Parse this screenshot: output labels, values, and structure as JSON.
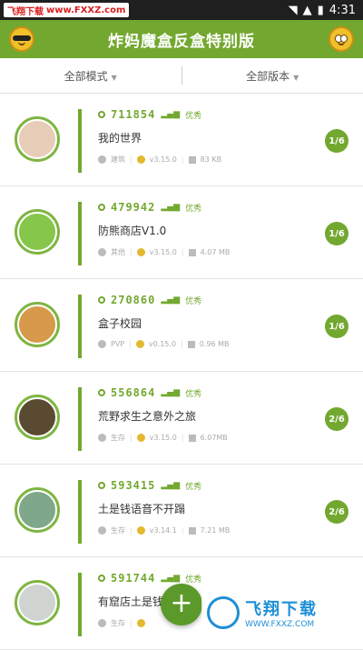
{
  "status_bar": {
    "watermark_site": "飞翔下载",
    "watermark_url": "www.FXXZ.com",
    "time": "4:31"
  },
  "header": {
    "title": "炸妈魔盒反盒特别版",
    "left_icon": "sunglasses-face-icon",
    "right_icon": "smile-face-icon"
  },
  "filters": {
    "mode": "全部模式",
    "version": "全部版本"
  },
  "items": [
    {
      "count": "711854",
      "quality": "优秀",
      "title": "我的世界",
      "type": "建筑",
      "version": "v3.15.0",
      "size": "83 KB",
      "ratio": "1/6"
    },
    {
      "count": "479942",
      "quality": "优秀",
      "title": "防熊商店V1.0",
      "type": "其他",
      "version": "v3.15.0",
      "size": "4.07 MB",
      "ratio": "1/6"
    },
    {
      "count": "270860",
      "quality": "优秀",
      "title": "盒子校园",
      "type": "PVP",
      "version": "v0.15.0",
      "size": "0.96 MB",
      "ratio": "1/6"
    },
    {
      "count": "556864",
      "quality": "优秀",
      "title": "荒野求生之意外之旅",
      "type": "生存",
      "version": "v3.15.0",
      "size": "6.07MB",
      "ratio": "2/6"
    },
    {
      "count": "593415",
      "quality": "优秀",
      "title": "土是钱语音不开蹋",
      "type": "生存",
      "version": "v3.14.1",
      "size": "7.21 MB",
      "ratio": "2/6"
    },
    {
      "count": "591744",
      "quality": "优秀",
      "title": "有窟店土是钱",
      "type": "生存",
      "version": "",
      "size": "",
      "ratio": ""
    }
  ],
  "fab": {
    "label": "+"
  },
  "watermark": {
    "text": "飞翔下载",
    "url": "WWW.FXXZ.COM"
  },
  "colors": {
    "primary": "#72a82f",
    "status_bar": "#1f1f1f"
  }
}
